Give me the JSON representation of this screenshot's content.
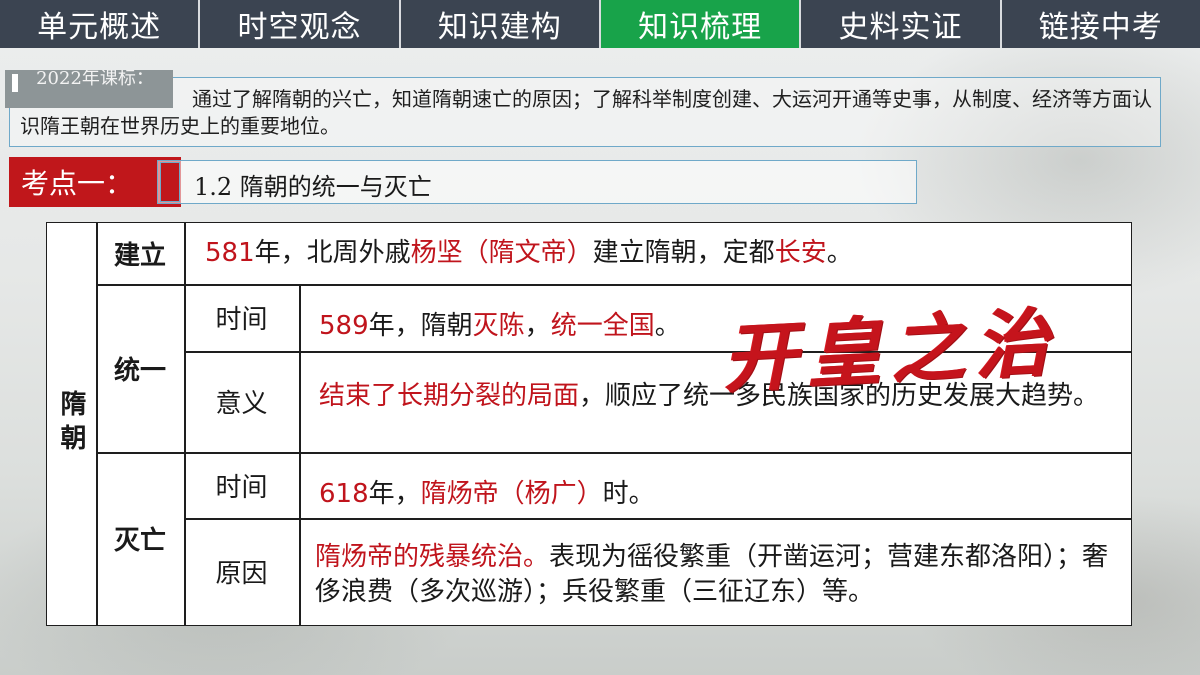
{
  "nav": {
    "tabs": [
      {
        "label": "单元概述",
        "active": false
      },
      {
        "label": "时空观念",
        "active": false
      },
      {
        "label": "知识建构",
        "active": false
      },
      {
        "label": "知识梳理",
        "active": true
      },
      {
        "label": "史料实证",
        "active": false
      },
      {
        "label": "链接中考",
        "active": false
      }
    ],
    "colors": {
      "bar": "#3b4451",
      "active": "#18a34a"
    }
  },
  "standard": {
    "tag": "2022年课标：",
    "text": "通过了解隋朝的兴亡，知道隋朝速亡的原因；了解科举制度创建、大运河开通等史事，从制度、经济等方面认识隋王朝在世界历史上的重要地位。"
  },
  "keypoint": {
    "label": "考点一：",
    "title": "1.2 隋朝的统一与灭亡"
  },
  "table": {
    "subject": "隋朝",
    "rows": {
      "founding": {
        "header": "建立",
        "segments": [
          {
            "t": "581",
            "red": true
          },
          {
            "t": "年，北周外戚",
            "red": false
          },
          {
            "t": "杨坚（隋文帝）",
            "red": true
          },
          {
            "t": "建立隋朝，定都",
            "red": false
          },
          {
            "t": "长安",
            "red": true
          },
          {
            "t": "。",
            "red": false
          }
        ]
      },
      "unify": {
        "header": "统一",
        "time_label": "时间",
        "time_segments": [
          {
            "t": "589",
            "red": true
          },
          {
            "t": "年，隋朝",
            "red": false
          },
          {
            "t": "灭陈",
            "red": true
          },
          {
            "t": "，",
            "red": false
          },
          {
            "t": "统一全国",
            "red": true
          },
          {
            "t": "。",
            "red": false
          }
        ],
        "meaning_label": "意义",
        "meaning_segments": [
          {
            "t": "结束了长期分裂的局面",
            "red": true
          },
          {
            "t": "，顺应了统一多民族国家的历史发展大趋势。",
            "red": false
          }
        ]
      },
      "fall": {
        "header": "灭亡",
        "time_label": "时间",
        "time_segments": [
          {
            "t": "618",
            "red": true
          },
          {
            "t": "年，",
            "red": false
          },
          {
            "t": "隋炀帝（杨广）",
            "red": true
          },
          {
            "t": "时。",
            "red": false
          }
        ],
        "cause_label": "原因",
        "cause_segments": [
          {
            "t": "隋炀帝的残暴统治。",
            "red": true
          },
          {
            "t": "表现为徭役繁重（开凿运河；营建东都洛阳）；奢侈浪费（多次巡游）；兵役繁重（三征辽东）等。",
            "red": false
          }
        ]
      }
    }
  },
  "stamp": "开皇之治",
  "accent_red": "#c0141c"
}
